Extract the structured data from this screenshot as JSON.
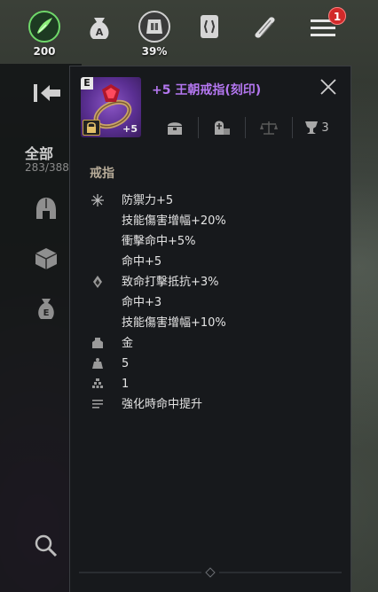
{
  "hud": {
    "energy_value": "200",
    "weight_value": "39%",
    "notification_count": "1"
  },
  "sidebar": {
    "category_label": "全部",
    "category_count": "283/388"
  },
  "item": {
    "grade": "E",
    "enhance_level": "+5",
    "name": "+5 王朝戒指(刻印)",
    "tab_trophy_count": "3",
    "type_label": "戒指",
    "stats": [
      {
        "icon": "star-burst-icon",
        "text": "防禦力+5"
      },
      {
        "icon": "",
        "text": "技能傷害增幅+20%"
      },
      {
        "icon": "",
        "text": "衝擊命中+5%"
      },
      {
        "icon": "",
        "text": "命中+5"
      },
      {
        "icon": "flame-gem-icon",
        "text": "致命打擊抵抗+3%"
      },
      {
        "icon": "",
        "text": "命中+3"
      },
      {
        "icon": "",
        "text": "技能傷害增幅+10%"
      },
      {
        "icon": "material-icon",
        "text": "金"
      },
      {
        "icon": "weight-icon",
        "text": "5"
      },
      {
        "icon": "stack-icon",
        "text": "1"
      },
      {
        "icon": "list-icon",
        "text": "強化時命中提升"
      }
    ]
  },
  "colors": {
    "item_name": "#b477f0",
    "panel_bg": "#17191c",
    "badge": "#d22a2a"
  }
}
